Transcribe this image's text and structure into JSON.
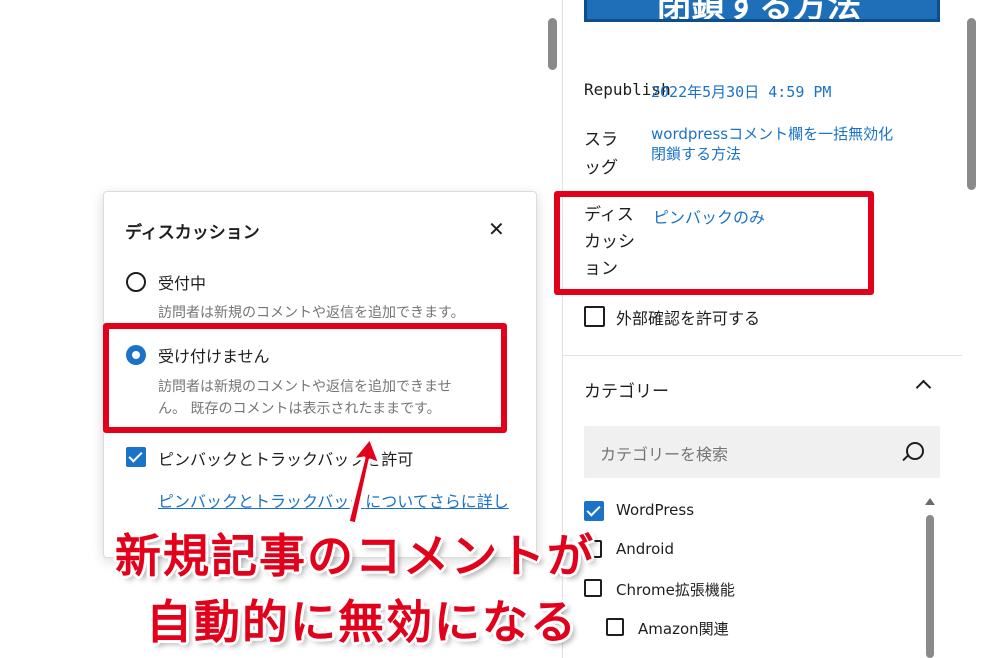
{
  "featured_image": {
    "text": "閉鎖する方法"
  },
  "sidebar": {
    "publish_label": "Republish",
    "publish_value": "2022年5月30日 4:59 PM",
    "slug_label": "スラッグ",
    "slug_value_line1": "wordpressコメント欄を一括無効化",
    "slug_value_line2": "閉鎖する方法",
    "discussion_label_1": "ディス",
    "discussion_label_2": "カッシ",
    "discussion_label_3": "ョン",
    "discussion_value": "ピンバックのみ",
    "external_check_label": "外部確認を許可する",
    "category_title": "カテゴリー",
    "category_search_placeholder": "カテゴリーを検索",
    "categories": [
      {
        "label": "WordPress",
        "checked": true
      },
      {
        "label": "Android",
        "checked": false
      },
      {
        "label": "Chrome拡張機能",
        "checked": false
      },
      {
        "label": "Amazon関連",
        "checked": false
      }
    ]
  },
  "popover": {
    "title": "ディスカッション",
    "close_icon": "close-icon",
    "option_open_label": "受付中",
    "option_open_help": "訪問者は新規のコメントや返信を追加できます。",
    "option_closed_label": "受け付けません",
    "option_closed_help_line1": "訪問者は新規のコメントや返信を追加できませ",
    "option_closed_help_line2": "ん。 既存のコメントは表示されたままです。",
    "pingback_label": "ピンバックとトラックバックを許可",
    "pingback_link": "ピンバックとトラックバックについてさらに詳し"
  },
  "annotation": {
    "caption_line1": "新規記事のコメントが",
    "caption_line2": "自動的に無効になる",
    "accent_color": "#e3001b"
  }
}
